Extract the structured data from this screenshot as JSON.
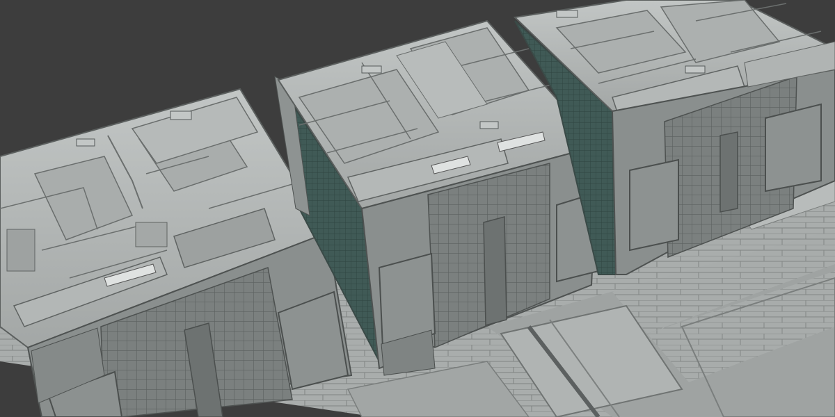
{
  "scene": {
    "description_visible_text": "",
    "palette": {
      "background": "#3d3d3d",
      "panel_light": "#b4b8b7",
      "panel_mid": "#9a9e9d",
      "panel_dark": "#6f7473",
      "grid_face": "#7a7f7e",
      "teal_face": "#3f5a56",
      "line": "#4a4e4d",
      "highlight": "#d6d9d8",
      "floor": "#a7abaa",
      "floor_line": "#7c807f"
    }
  }
}
